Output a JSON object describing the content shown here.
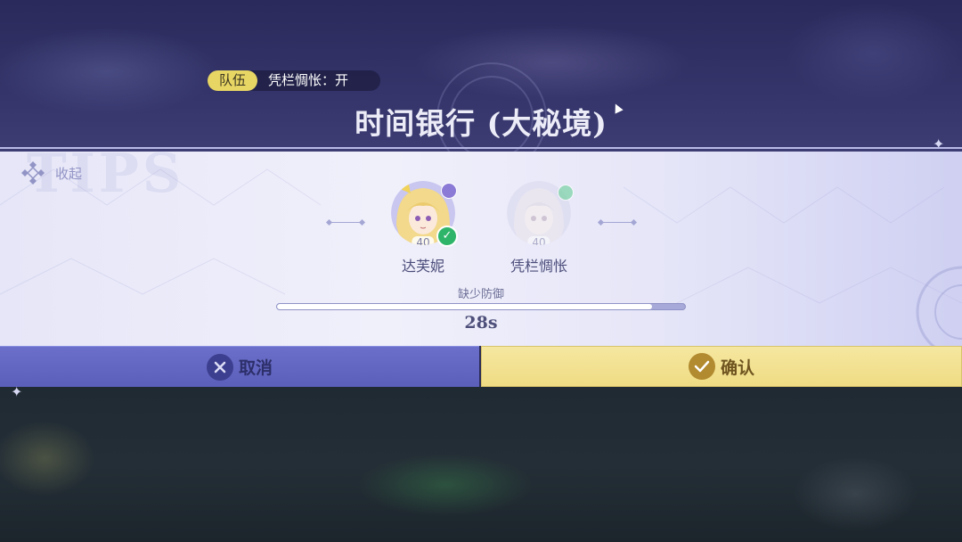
{
  "header": {
    "team_tag": "队伍",
    "status_text": "凭栏惆怅：开",
    "title": "时间银行 (大秘境)"
  },
  "panel": {
    "collapse_label": "收起",
    "members": [
      {
        "name": "达芙妮",
        "level": "40",
        "ready": true
      },
      {
        "name": "凭栏惆怅",
        "level": "40",
        "ready": false
      }
    ],
    "progress_label": "缺少防御",
    "progress_fraction": 0.92,
    "timer": "28s"
  },
  "buttons": {
    "cancel_label": "取消",
    "confirm_label": "确认"
  },
  "colors": {
    "cancel_bg": "#6064c0",
    "confirm_bg": "#f1df8b",
    "ready_check": "#2fb56a",
    "team_tag": "#e7d564"
  },
  "icons": {
    "collapse": "diamond-arrows-icon",
    "cancel": "x-circle-icon",
    "confirm": "check-circle-icon"
  }
}
